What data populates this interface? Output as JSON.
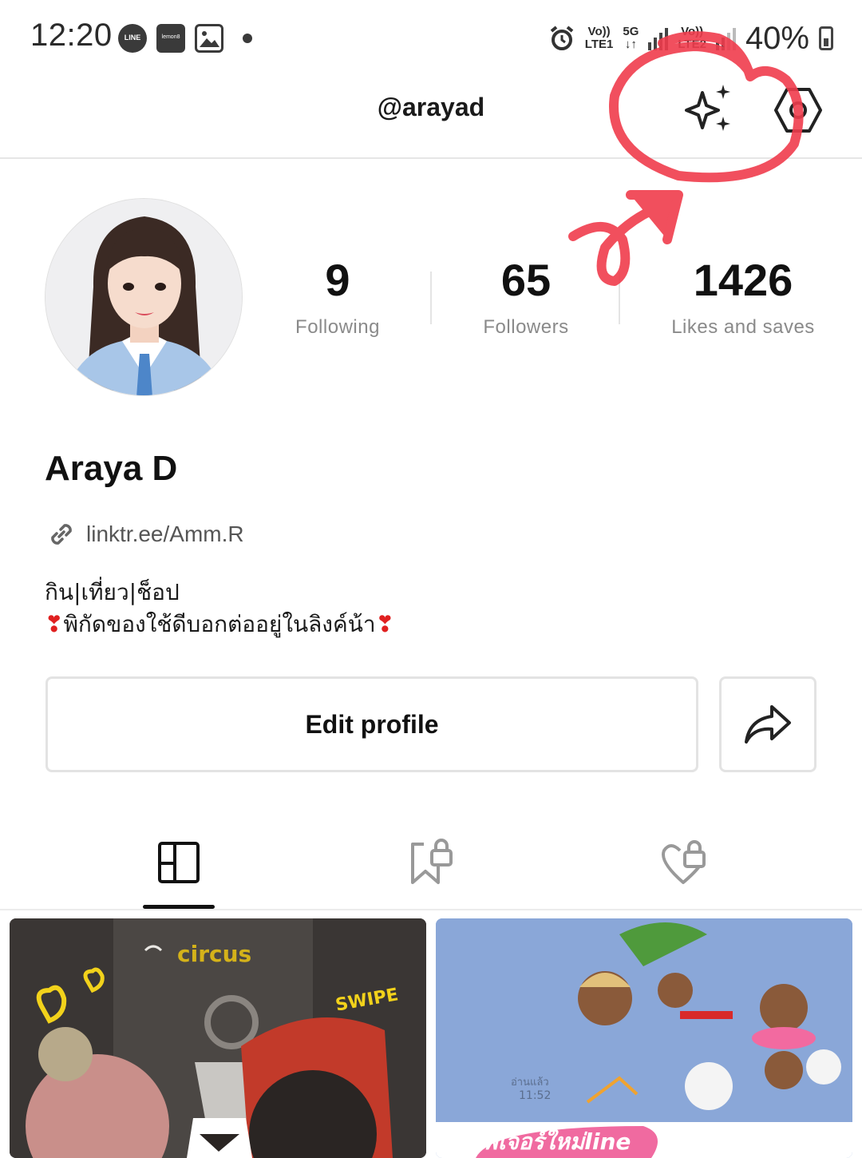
{
  "status_bar": {
    "time": "12:20",
    "notif_icons": [
      "line-app-icon",
      "lemon8-app-icon",
      "gallery-icon",
      "more-dot-icon"
    ],
    "line_label": "LINE",
    "lemon_label": "lemon8",
    "sim1_top": "Vo))",
    "sim1_bottom": "LTE1",
    "network_top": "5G",
    "network_bottom": "↓↑",
    "sim2_top": "Vo))",
    "sim2_bottom": "LTE2",
    "battery": "40%"
  },
  "header": {
    "username": "@arayad",
    "icons": [
      "sparkle-icon",
      "settings-icon"
    ]
  },
  "profile": {
    "stats": [
      {
        "value": "9",
        "label": "Following"
      },
      {
        "value": "65",
        "label": "Followers"
      },
      {
        "value": "1426",
        "label": "Likes and saves"
      }
    ],
    "display_name": "Araya D",
    "link": "linktr.ee/Amm.R",
    "bio_line1": "กิน|เที่ยว|ช็อป",
    "bio_line2_heart_left": "❣",
    "bio_line2": "พิกัดของใช้ดีบอกต่ออยู่ในลิงค์น้า",
    "bio_line2_heart_right": "❣"
  },
  "actions": {
    "edit_profile": "Edit profile",
    "share_icon": "share-arrow-icon"
  },
  "tabs": [
    {
      "name": "posts",
      "icon": "grid-layout-icon",
      "active": true
    },
    {
      "name": "saved",
      "icon": "bookmark-lock-icon",
      "active": false
    },
    {
      "name": "liked",
      "icon": "heart-lock-icon",
      "active": false
    }
  ],
  "grid": {
    "item1_text": "circus",
    "item1_text2": "SWIPE",
    "item2_read": "อ่านแล้ว",
    "item2_time": "11:52",
    "item2_banner": "ฟีเจอร์ใหม่line"
  },
  "colors": {
    "annotation_red": "#f03c4c",
    "text_primary": "#111111",
    "text_secondary": "#8a8a8a",
    "divider": "#e6e6e6"
  }
}
